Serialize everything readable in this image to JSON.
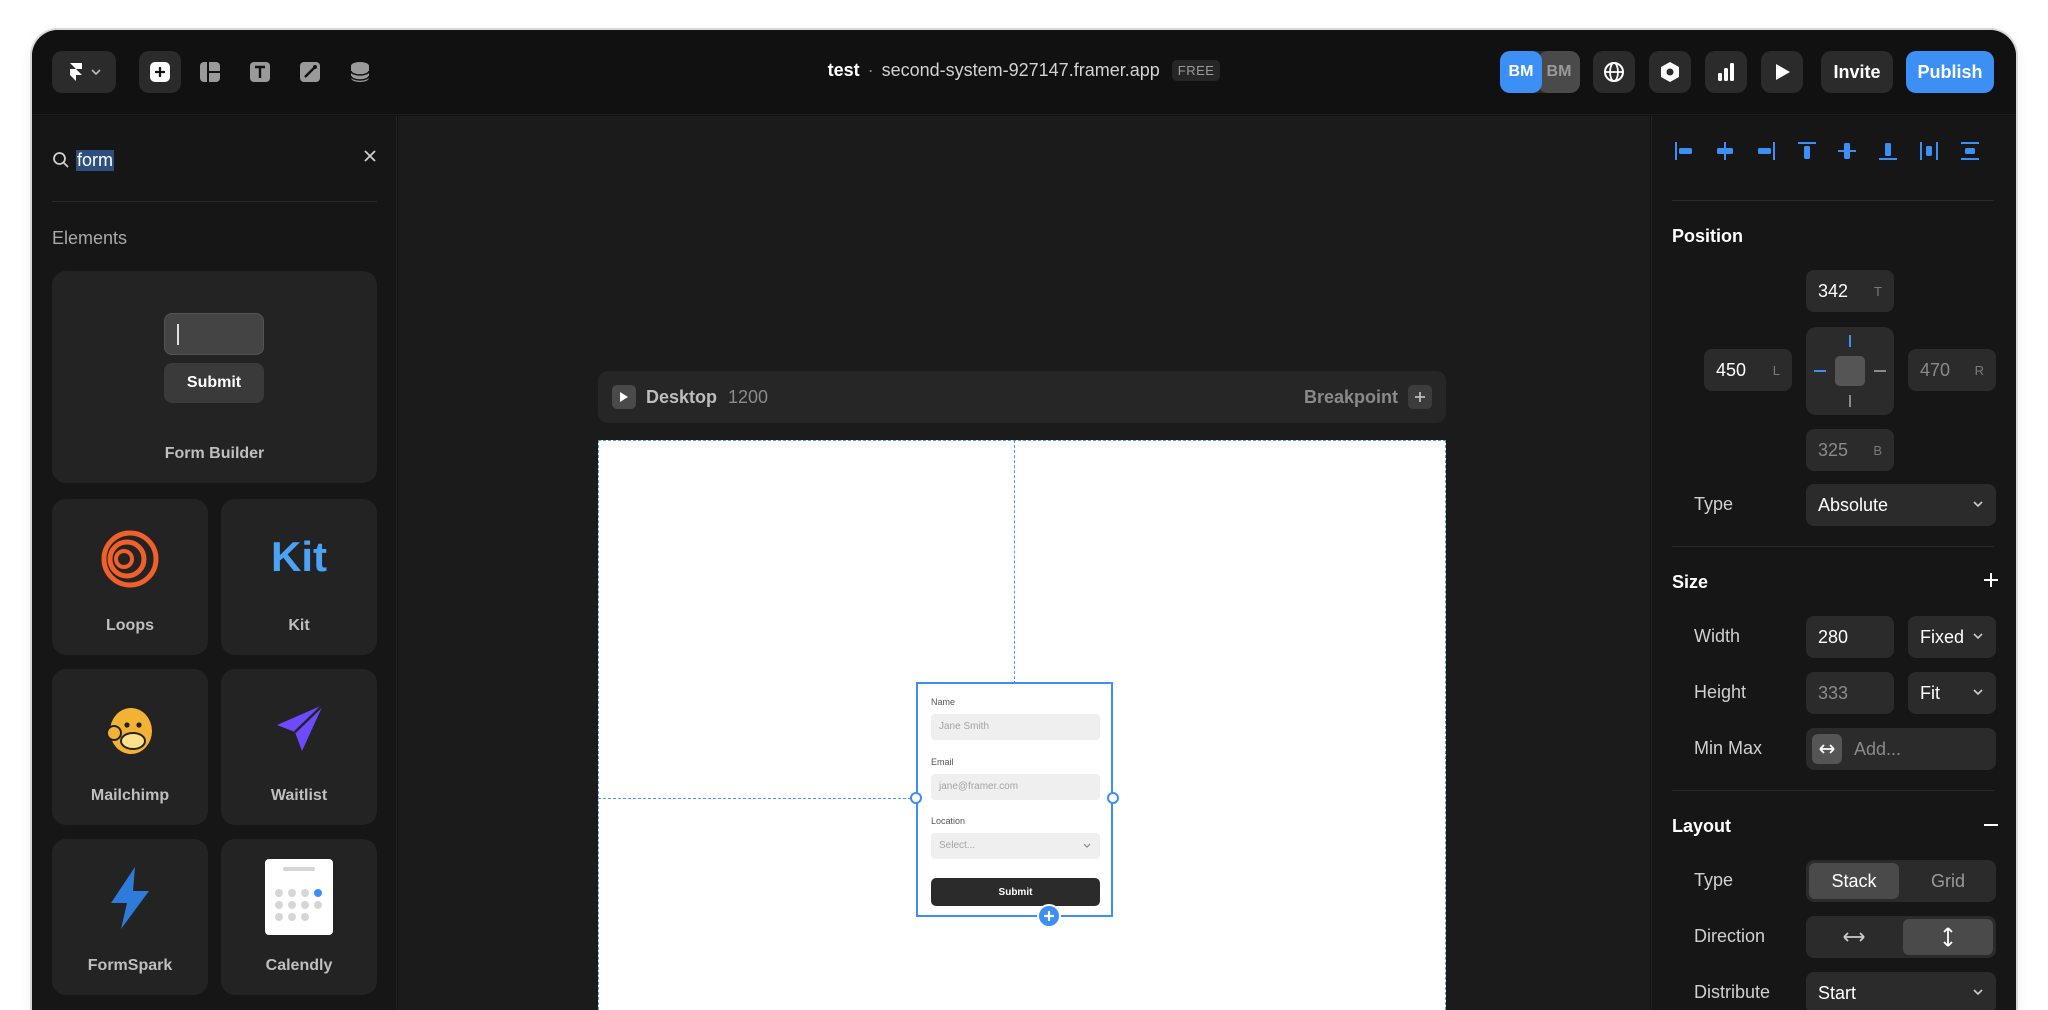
{
  "topbar": {
    "project": "test",
    "separator": "·",
    "domain": "second-system-927147.framer.app",
    "plan_badge": "FREE",
    "avatars": [
      "BM",
      "BM"
    ],
    "invite_label": "Invite",
    "publish_label": "Publish",
    "tools": [
      "insert-icon",
      "layout-icon",
      "text-icon",
      "vector-icon",
      "cms-icon"
    ],
    "right_icons": [
      "globe-icon",
      "settings-icon",
      "analytics-icon",
      "preview-play-icon"
    ]
  },
  "left_panel": {
    "search_value": "form",
    "section": "Elements",
    "form_builder": {
      "submit": "Submit",
      "label": "Form Builder"
    },
    "cards": [
      {
        "label": "Loops",
        "icon": "loops-icon"
      },
      {
        "label": "Kit",
        "icon": "kit-logo"
      },
      {
        "label": "Mailchimp",
        "icon": "mailchimp-icon"
      },
      {
        "label": "Waitlist",
        "icon": "waitlist-icon"
      },
      {
        "label": "FormSpark",
        "icon": "formspark-icon"
      },
      {
        "label": "Calendly",
        "icon": "calendly-icon"
      }
    ]
  },
  "canvas": {
    "breakpoint_name": "Desktop",
    "breakpoint_width": "1200",
    "breakpoint_label": "Breakpoint",
    "form": {
      "name_label": "Name",
      "name_placeholder": "Jane Smith",
      "email_label": "Email",
      "email_placeholder": "jane@framer.com",
      "location_label": "Location",
      "location_placeholder": "Select...",
      "submit": "Submit"
    }
  },
  "right_panel": {
    "position": {
      "title": "Position",
      "top": "342",
      "top_suffix": "T",
      "left": "450",
      "left_suffix": "L",
      "right": "470",
      "right_suffix": "R",
      "bottom": "325",
      "bottom_suffix": "B",
      "type_label": "Type",
      "type_value": "Absolute"
    },
    "size": {
      "title": "Size",
      "width_label": "Width",
      "width_value": "280",
      "width_mode": "Fixed",
      "height_label": "Height",
      "height_value": "333",
      "height_mode": "Fit",
      "minmax_label": "Min Max",
      "minmax_placeholder": "Add..."
    },
    "layout": {
      "title": "Layout",
      "type_label": "Type",
      "type_options": [
        "Stack",
        "Grid"
      ],
      "type_selected": "Stack",
      "direction_label": "Direction",
      "distribute_label": "Distribute",
      "distribute_value": "Start"
    }
  },
  "colors": {
    "accent": "#3b8ff5",
    "panel": "#161616",
    "canvas": "#1b1b1b",
    "control": "#2b2b2b"
  }
}
